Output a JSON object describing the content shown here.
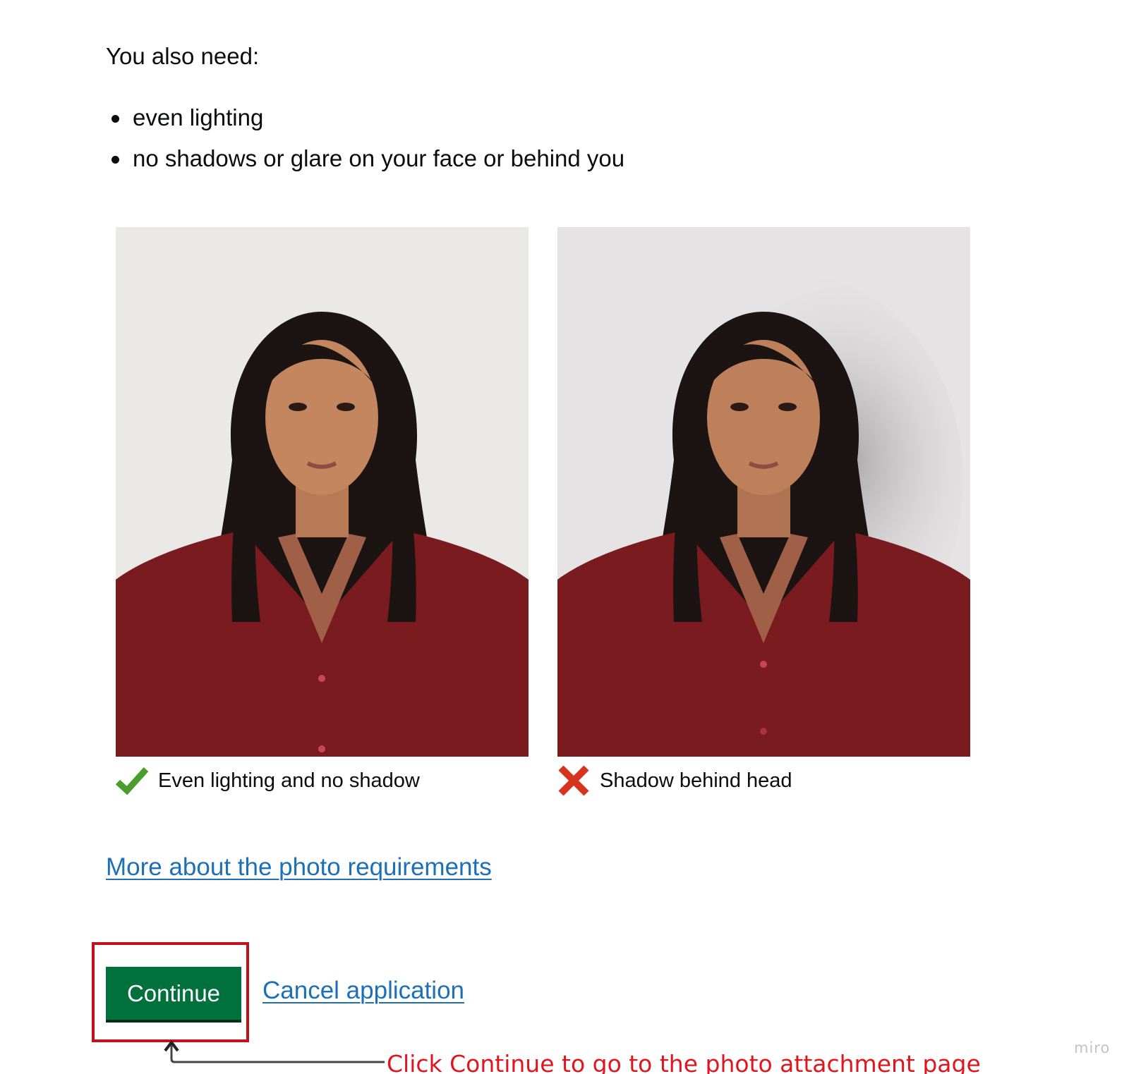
{
  "intro": {
    "text": "You also need:"
  },
  "requirements": [
    "even lighting",
    "no shadows or glare on your face or behind you"
  ],
  "examples": [
    {
      "caption": "Even lighting and no shadow",
      "status": "good",
      "icon": "tick-icon",
      "status_color": "#4a9e2d"
    },
    {
      "caption": "Shadow behind head",
      "status": "bad",
      "icon": "cross-icon",
      "status_color": "#d4351c"
    }
  ],
  "links": {
    "more_photo_requirements": "More about the photo requirements",
    "cancel": "Cancel application"
  },
  "actions": {
    "continue_label": "Continue"
  },
  "annotation": {
    "text": "Click Continue to go to the photo attachment page",
    "color": "#e0161f"
  },
  "watermark": "miro",
  "colors": {
    "link": "#1d70b8",
    "button": "#00703c",
    "highlight": "#c0111c",
    "blouse": "#7a1c1f",
    "background": "#eae7e7"
  }
}
